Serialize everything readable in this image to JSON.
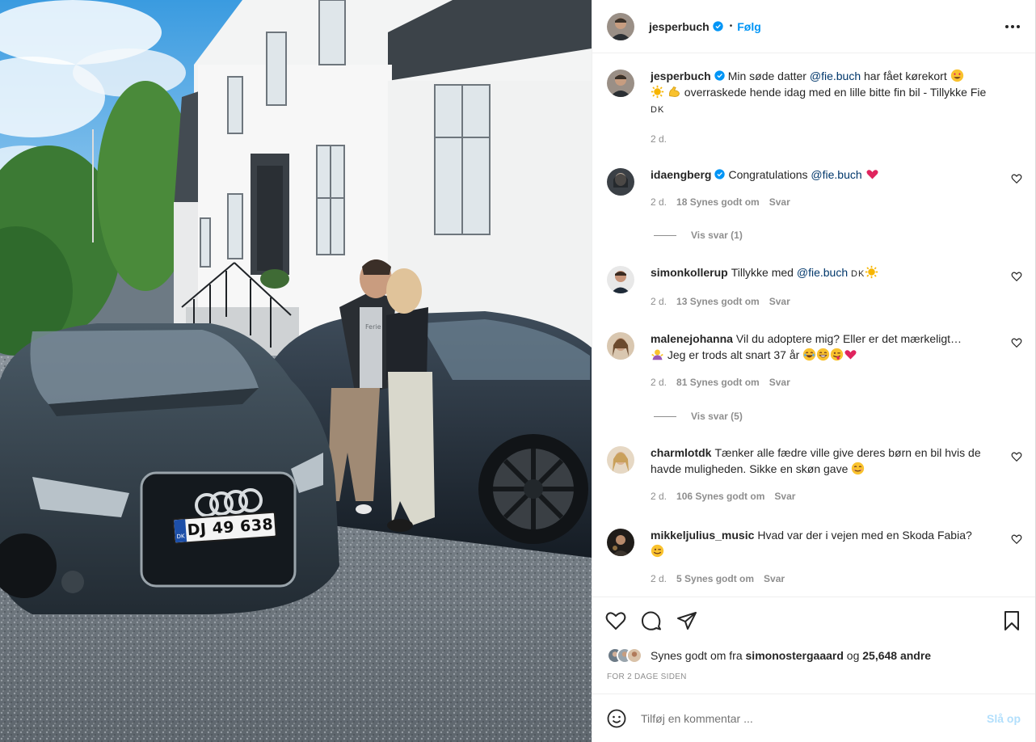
{
  "photo": {
    "plate": "DJ 49 638",
    "plate_country": "DK",
    "sign": "Ferie"
  },
  "header": {
    "username": "jesperbuch",
    "dot": "•",
    "follow_label": "Følg"
  },
  "caption": {
    "username": "jesperbuch",
    "text_1": "Min søde datter",
    "mention": "@fie.buch",
    "text_2": "har fået kørekort",
    "text_3": "overraskede hende idag med en lille bitte fin bil - Tillykke Fie",
    "flag": "DK",
    "time": "2 d."
  },
  "comments": [
    {
      "username": "idaengberg",
      "text": "Congratulations",
      "mention": "@fie.buch",
      "time": "2 d.",
      "likes": "18 Synes godt om",
      "reply": "Svar",
      "view_replies": "Vis svar (1)"
    },
    {
      "username": "simonkollerup",
      "text": "Tillykke med",
      "mention": "@fie.buch",
      "flag": "DK",
      "time": "2 d.",
      "likes": "13 Synes godt om",
      "reply": "Svar"
    },
    {
      "username": "malenejohanna",
      "text": "Vil du adoptere mig? Eller er det mærkeligt…",
      "text_2": "Jeg er trods alt snart 37 år",
      "time": "2 d.",
      "likes": "81 Synes godt om",
      "reply": "Svar",
      "view_replies": "Vis svar (5)"
    },
    {
      "username": "charmlotdk",
      "text": "Tænker alle fædre ville give deres børn en bil hvis de havde muligheden. Sikke en skøn gave",
      "time": "2 d.",
      "likes": "106 Synes godt om",
      "reply": "Svar"
    },
    {
      "username": "mikkeljulius_music",
      "text": "Hvad var der i vejen med en Skoda Fabia?",
      "time": "2 d.",
      "likes": "5 Synes godt om",
      "reply": "Svar"
    }
  ],
  "likes_line": {
    "prefix": "Synes godt om fra",
    "user": "simonostergaaard",
    "middle": "og",
    "count": "25,648 andre"
  },
  "timestamp": "FOR 2 DAGE SIDEN",
  "add_comment": {
    "placeholder": "Tilføj en kommentar ...",
    "post_label": "Slå op"
  },
  "colors": {
    "accent": "#0095f6",
    "post_disabled": "#b2dffc",
    "mention": "#00376b",
    "muted": "#8e8e8e"
  }
}
